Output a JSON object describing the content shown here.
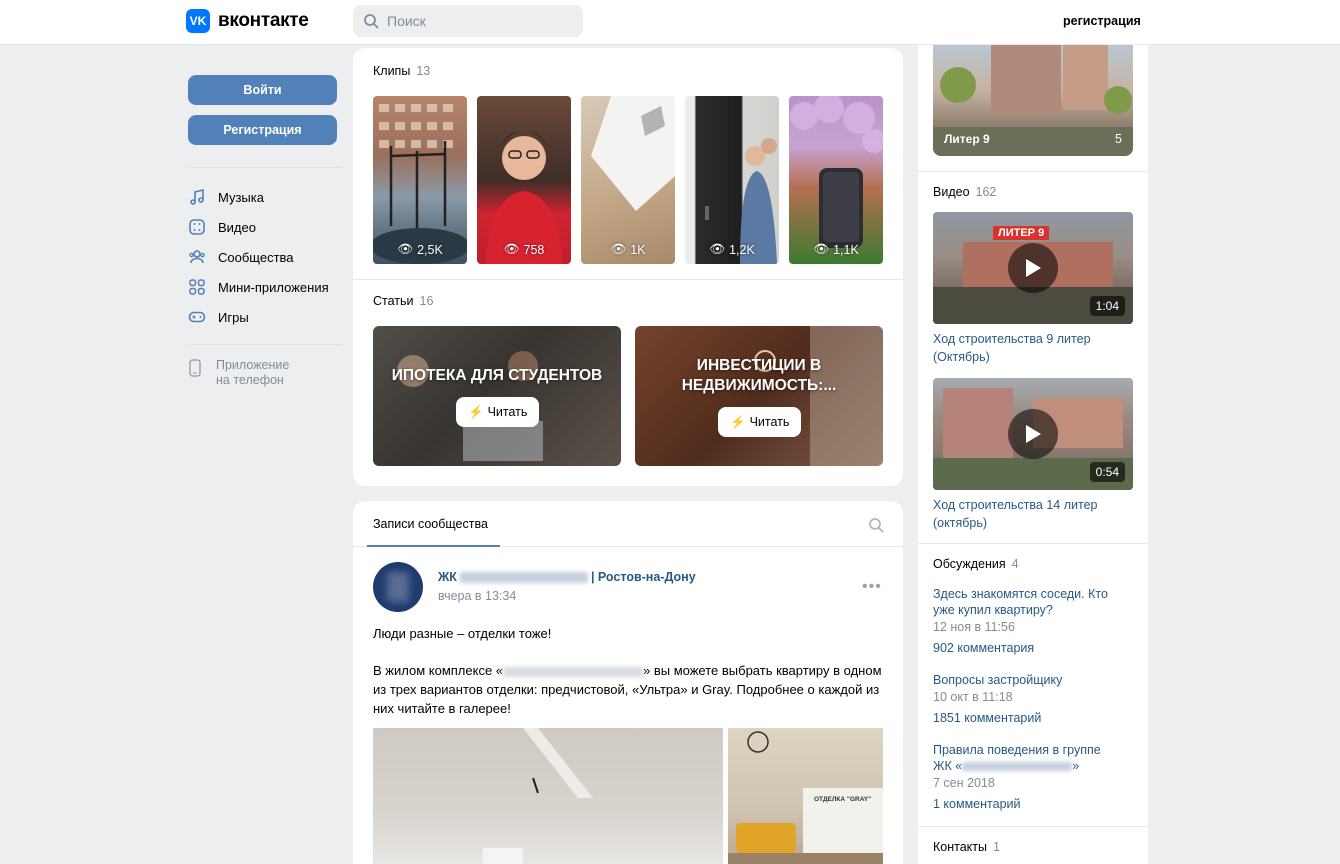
{
  "header": {
    "logo_mark": "VK",
    "logo_text": "вконтакте",
    "search_placeholder": "Поиск",
    "register_link": "регистрация"
  },
  "left_nav": {
    "login_button": "Войти",
    "register_button": "Регистрация",
    "items": [
      {
        "label": "Музыка",
        "icon": "music-icon"
      },
      {
        "label": "Видео",
        "icon": "video-icon"
      },
      {
        "label": "Сообщества",
        "icon": "communities-icon"
      },
      {
        "label": "Мини-приложения",
        "icon": "mini-apps-icon"
      },
      {
        "label": "Игры",
        "icon": "games-icon"
      }
    ],
    "phone_app_line1": "Приложение",
    "phone_app_line2": "на телефон"
  },
  "clips": {
    "title": "Клипы",
    "count": "13",
    "items": [
      {
        "views": "2,5K"
      },
      {
        "views": "758"
      },
      {
        "views": "1K"
      },
      {
        "views": "1,2K"
      },
      {
        "views": "1,1K"
      }
    ]
  },
  "articles": {
    "title": "Статьи",
    "count": "16",
    "items": [
      {
        "title": "ИПОТЕКА ДЛЯ СТУДЕНТОВ",
        "button": "Читать"
      },
      {
        "title": "ИНВЕСТИЦИИ В НЕДВИЖИМОСТЬ:...",
        "button": "Читать"
      }
    ]
  },
  "wall": {
    "tab_label": "Записи сообщества",
    "post": {
      "author_prefix": "ЖК",
      "author_suffix": "| Ростов-на-Дону",
      "time": "вчера в 13:34",
      "more": "•••",
      "line1": "Люди разные – отделки тоже!",
      "para_start": "В жилом комплексе «",
      "para_end": "» вы можете выбрать квартиру в одном из трех вариантов отделки: предчистовой, «Ультра» и Gray. Подробнее о каждой из них читайте в галерее!",
      "photo2_caption": "ОТДЕЛКА \"GRAY\""
    }
  },
  "right": {
    "album": {
      "label": "Литер 9",
      "count": "5"
    },
    "videos": {
      "title": "Видео",
      "count": "162",
      "items": [
        {
          "duration": "1:04",
          "title": "Ход строительства 9 литер (Октябрь)",
          "overlay": "ЛИТЕР 9"
        },
        {
          "duration": "0:54",
          "title": "Ход строительства 14 литер (октябрь)"
        }
      ]
    },
    "discussions": {
      "title": "Обсуждения",
      "count": "4",
      "items": [
        {
          "title": "Здесь знакомятся соседи. Кто уже купил квартиру?",
          "date": "12 ноя в 11:56",
          "comments": "902 комментария"
        },
        {
          "title": "Вопросы застройщику",
          "date": "10 окт в 11:18",
          "comments": "1851 комментарий"
        },
        {
          "title_start": "Правила поведения в группе ЖК «",
          "title_end": "»",
          "date": "7 сен 2018",
          "comments": "1 комментарий"
        }
      ]
    },
    "contacts": {
      "title": "Контакты",
      "count": "1"
    }
  }
}
